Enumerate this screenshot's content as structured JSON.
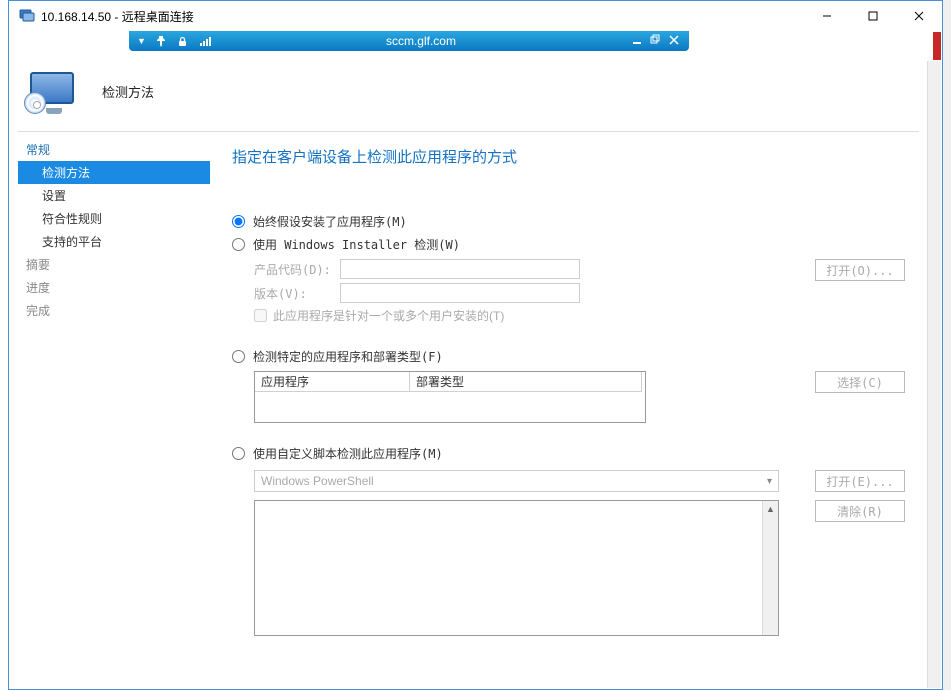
{
  "rdp": {
    "title": "10.168.14.50 - 远程桌面连接",
    "host": "sccm.glf.com"
  },
  "header": {
    "title": "检测方法"
  },
  "nav": {
    "items": [
      {
        "label": "常规",
        "level": 0,
        "state": "done"
      },
      {
        "label": "检测方法",
        "level": 1,
        "state": "sel"
      },
      {
        "label": "设置",
        "level": 1,
        "state": ""
      },
      {
        "label": "符合性规则",
        "level": 1,
        "state": ""
      },
      {
        "label": "支持的平台",
        "level": 1,
        "state": ""
      },
      {
        "label": "摘要",
        "level": 0,
        "state": "pending"
      },
      {
        "label": "进度",
        "level": 0,
        "state": "pending"
      },
      {
        "label": "完成",
        "level": 0,
        "state": "pending"
      }
    ]
  },
  "content": {
    "heading": "指定在客户端设备上检测此应用程序的方式",
    "opt1": "始终假设安装了应用程序(M)",
    "opt2": "使用 Windows Installer 检测(W)",
    "opt2_product_label": "产品代码(D):",
    "opt2_version_label": "版本(V):",
    "opt2_open_btn": "打开(O)...",
    "opt2_peruser": "此应用程序是针对一个或多个用户安装的(T)",
    "opt3": "检测特定的应用程序和部署类型(F)",
    "opt3_col_app": "应用程序",
    "opt3_col_dep": "部署类型",
    "opt3_select_btn": "选择(C)",
    "opt4": "使用自定义脚本检测此应用程序(M)",
    "opt4_lang": "Windows PowerShell",
    "opt4_open_btn": "打开(E)...",
    "opt4_clear_btn": "清除(R)",
    "selected": "opt1"
  }
}
